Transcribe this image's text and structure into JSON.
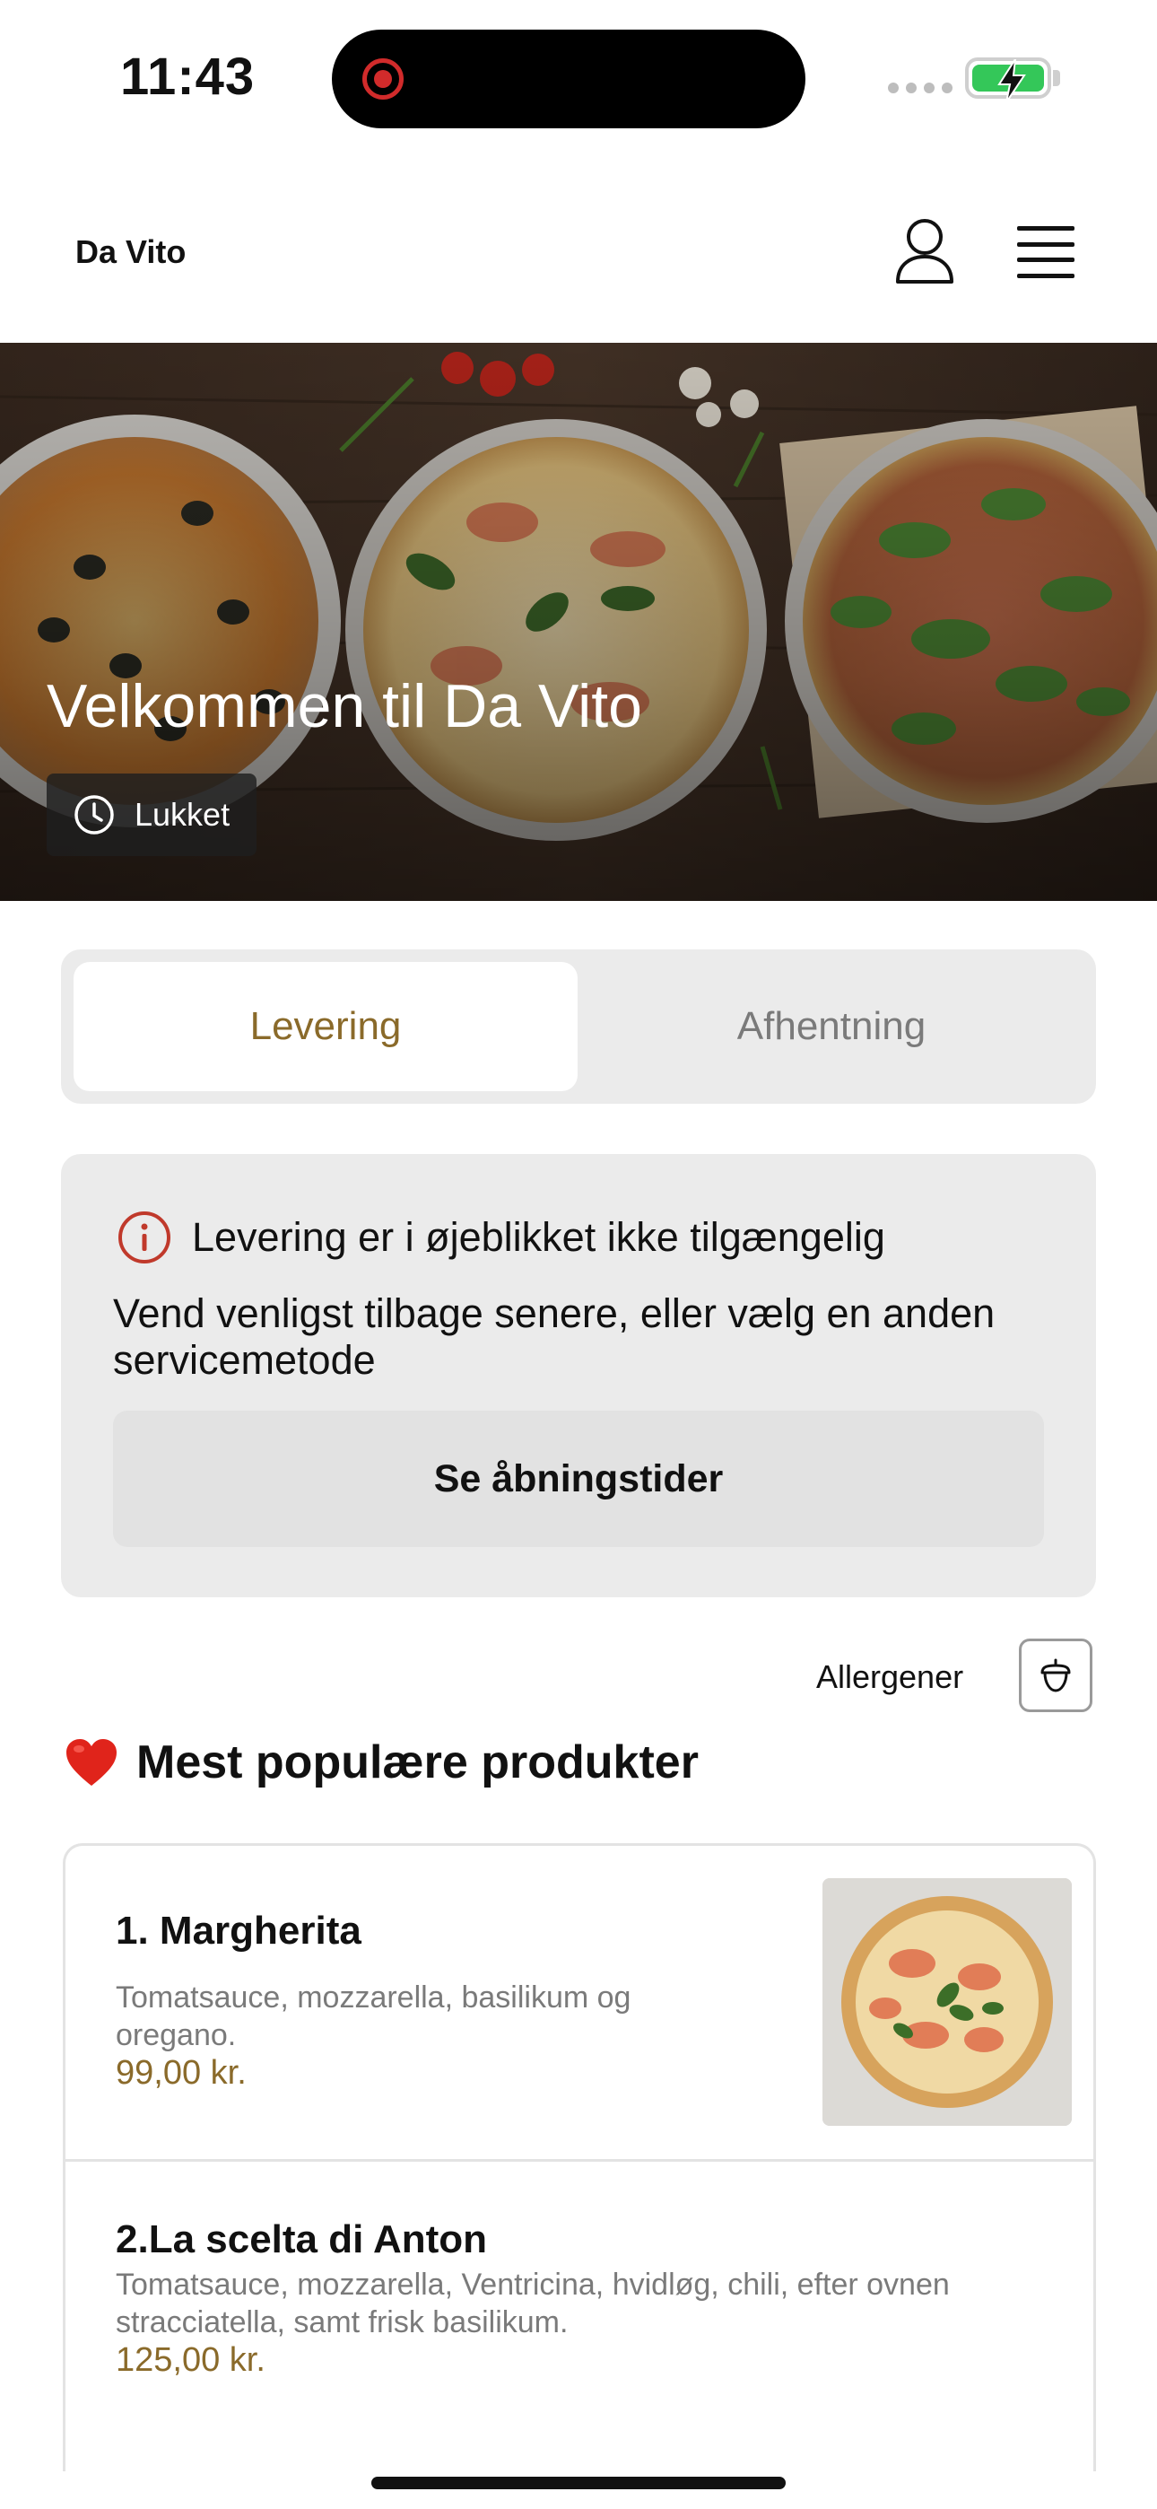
{
  "status_bar": {
    "time": "11:43",
    "recording_icon": "screen-record-icon",
    "battery_state": "charging",
    "battery_color": "#34c759"
  },
  "header": {
    "brand": "Da Vito",
    "user_icon": "user-icon",
    "menu_icon": "hamburger-menu-icon"
  },
  "hero": {
    "title": "Velkommen til Da Vito",
    "status_label": "Lukket",
    "status_icon": "clock-icon"
  },
  "order_mode": {
    "tabs": [
      {
        "label": "Levering",
        "active": true
      },
      {
        "label": "Afhentning",
        "active": false
      }
    ],
    "accent_color": "#8a6a2a"
  },
  "notice": {
    "icon": "info-icon",
    "title": "Levering er i øjeblikket ikke tilgængelig",
    "body": "Vend venligst tilbage senere, eller vælg en anden servicemetode",
    "button_label": "Se åbningstider"
  },
  "allergens": {
    "label": "Allergener",
    "icon": "acorn-icon"
  },
  "popular": {
    "icon": "heart-icon",
    "title": "Mest populære produkter",
    "products": [
      {
        "name": "1. Margherita",
        "description": "Tomatsauce, mozzarella, basilikum og oregano.",
        "price": "99,00 kr.",
        "has_image": true
      },
      {
        "name": "2.La scelta di Anton",
        "description": "Tomatsauce, mozzarella, Ventricina, hvidløg, chili, efter ovnen stracciatella, samt frisk basilikum.",
        "price": "125,00 kr.",
        "has_image": false
      }
    ]
  }
}
